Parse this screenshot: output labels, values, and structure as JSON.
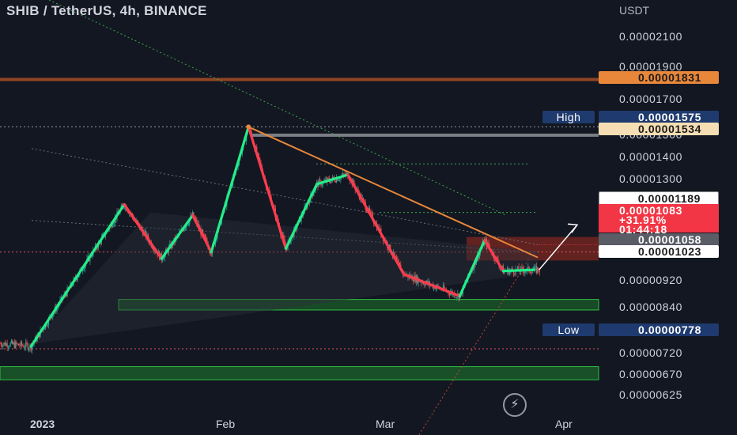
{
  "header": {
    "title": "SHIB / TetherUS, 4h, BINANCE",
    "unit": "USDT"
  },
  "colors": {
    "background": "#131722",
    "bull": "#26a69a",
    "bear": "#ef5350",
    "zigzag_up": "#22ee88",
    "zigzag_down": "#ff3b4f",
    "resistance": "#e8873a",
    "support_zone": "#1f8a2e",
    "resistance_band": "#c0311e"
  },
  "chart_data": {
    "type": "candlestick",
    "symbol": "SHIB / TetherUS",
    "interval": "4h",
    "exchange": "BINANCE",
    "y_scale": "log",
    "y_range": [
      5.8e-06,
      2.26e-05
    ],
    "x_ticks": [
      "2023",
      "Feb",
      "Mar",
      "Apr"
    ],
    "y_ticks": [
      "0.00002100",
      "0.00001900",
      "0.00001700",
      "0.00001500",
      "0.00001400",
      "0.00001300",
      "0.00000920",
      "0.00000840",
      "0.00000720",
      "0.00000670",
      "0.00000625"
    ],
    "price_labels": {
      "horizontal_resistance": "0.00001831",
      "high_label": "High",
      "high_value": "0.00001575",
      "prior_high": "0.00001534",
      "target": "0.00001189",
      "last_price": "0.00001083",
      "change": "+31.91%",
      "countdown": "01:44:18",
      "level_a": "0.00001058",
      "level_b": "0.00001023",
      "low_label": "Low",
      "low_value": "0.00000778"
    },
    "zigzag_pivots": [
      {
        "t": "Dec 31",
        "price": 7.84e-06
      },
      {
        "t": "Jan 15",
        "price": 1.231e-05
      },
      {
        "t": "Jan 21",
        "price": 1.036e-05
      },
      {
        "t": "Jan 26",
        "price": 1.189e-05
      },
      {
        "t": "Jan 29",
        "price": 1.058e-05
      },
      {
        "t": "Feb 04",
        "price": 1.575e-05
      },
      {
        "t": "Feb 10",
        "price": 1.07e-05
      },
      {
        "t": "Feb 15",
        "price": 1.313e-05
      },
      {
        "t": "Feb 20",
        "price": 1.353e-05
      },
      {
        "t": "Mar 01",
        "price": 9.86e-06
      },
      {
        "t": "Mar 10",
        "price": 9.2e-06
      },
      {
        "t": "Mar 14",
        "price": 1.098e-05
      },
      {
        "t": "Mar 17",
        "price": 9.96e-06
      },
      {
        "t": "Mar 22",
        "price": 1e-05
      }
    ]
  }
}
